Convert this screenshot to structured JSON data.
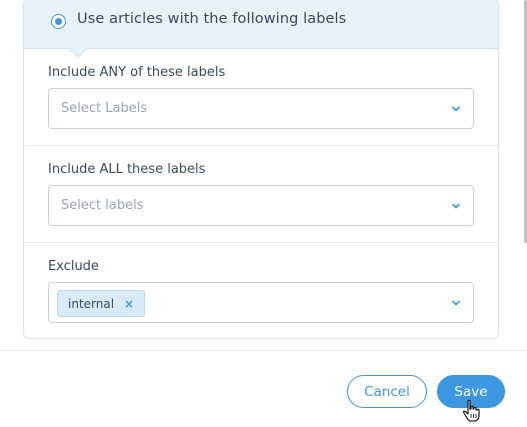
{
  "option": {
    "label": "Use articles with the following labels",
    "selected": true
  },
  "fields": {
    "include_any": {
      "label": "Include ANY of these labels",
      "placeholder": "Select Labels"
    },
    "include_all": {
      "label": "Include ALL these labels",
      "placeholder": "Select labels"
    },
    "exclude": {
      "label": "Exclude",
      "tags": [
        "internal"
      ],
      "remove_glyph": "×"
    }
  },
  "footer": {
    "cancel_label": "Cancel",
    "save_label": "Save"
  },
  "colors": {
    "accent": "#3a97e0",
    "header_bg": "#e6f2fc",
    "tag_bg": "#d9ebf9",
    "text": "#3d4a55",
    "placeholder": "#9aa4ad"
  },
  "icons": {
    "radio": "radio-selected-icon",
    "dropdown": "chevron-down-icon",
    "remove": "remove-tag-icon",
    "cursor": "hand-pointer-icon"
  }
}
